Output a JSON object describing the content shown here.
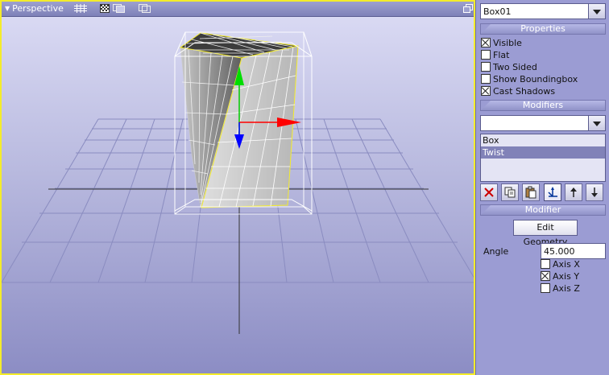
{
  "viewport": {
    "title": "Perspective",
    "icons": [
      "grid-icon",
      "shaded-view-icon",
      "wireframe-view-icon",
      "layers-view-icon",
      "maximize-icon"
    ]
  },
  "panel": {
    "object_dropdown": {
      "value": "Box01"
    },
    "properties": {
      "header": "Properties",
      "checkboxes": [
        {
          "label": "Visible",
          "checked": true
        },
        {
          "label": "Flat",
          "checked": false
        },
        {
          "label": "Two Sided",
          "checked": false
        },
        {
          "label": "Show Boundingbox",
          "checked": false
        },
        {
          "label": "Cast Shadows",
          "checked": true
        }
      ]
    },
    "modifiers": {
      "header": "Modifiers",
      "dropdown_value": "",
      "list": [
        {
          "label": "Box",
          "selected": false
        },
        {
          "label": "Twist",
          "selected": true
        }
      ],
      "toolbar": [
        "delete-icon",
        "copy-icon",
        "paste-icon",
        "axes-icon",
        "move-up-icon",
        "move-down-icon"
      ]
    },
    "modifier": {
      "header": "Modifier",
      "edit_button": "Edit Geometry",
      "angle_label": "Angle",
      "angle_value": "45.000",
      "axes": [
        {
          "label": "Axis X",
          "checked": false
        },
        {
          "label": "Axis Y",
          "checked": true
        },
        {
          "label": "Axis Z",
          "checked": false
        }
      ]
    }
  },
  "colors": {
    "viewport_border": "#f4ec2a",
    "panel_bg": "#9b9cd3",
    "axis_x": "#ff0000",
    "axis_y": "#00cc00",
    "axis_z": "#0000ff"
  }
}
